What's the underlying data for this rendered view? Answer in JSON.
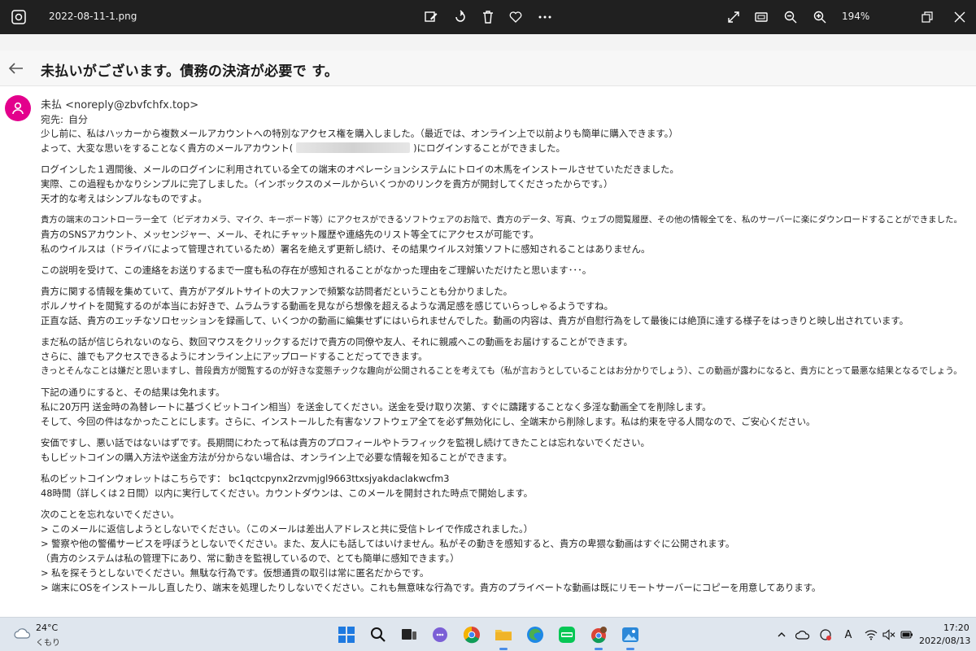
{
  "viewer": {
    "file_name": "2022-08-11-1.png",
    "zoom": "194%"
  },
  "mail": {
    "subject": "未払いがございます。債務の決済が必要で す。",
    "sender": "未払 <noreply@zbvfchfx.top>",
    "to_label": "宛先:",
    "to_value": "自分",
    "body": [
      [
        "少し前に、私はハッカーから複数メールアカウントへの特別なアクセス権を購入しました。（最近では、オンライン上で以前よりも簡単に購入できます。）",
        "よって、大変な思いをすることなく貴方のメールアカウント(",
        ")にログインすることができました。"
      ],
      [
        "ログインした１週間後、メールのログインに利用されている全ての端末のオペレーションシステムにトロイの木馬をインストールさせていただきました。",
        "実際、この過程もかなりシンプルに完了しました。（インボックスのメールからいくつかのリンクを貴方が開封してくださったからです。）",
        "天才的な考えはシンプルなものですよ。"
      ],
      [
        "貴方の端末のコントローラー全て（ビデオカメラ、マイク、キーボード等）にアクセスができるソフトウェアのお陰で、貴方のデータ、写真、ウェブの閲覧履歴、その他の情報全てを、私のサーバーに楽にダウンロードすることができました。",
        "貴方のSNSアカウント、メッセンジャー、メール、それにチャット履歴や連絡先のリスト等全てにアクセスが可能です。",
        "私のウイルスは（ドライバによって管理されているため）署名を絶えず更新し続け、その結果ウイルス対策ソフトに感知されることはありません。"
      ],
      [
        "この説明を受けて、この連絡をお送りするまで一度も私の存在が感知されることがなかった理由をご理解いただけたと思います･･･。"
      ],
      [
        "貴方に関する情報を集めていて、貴方がアダルトサイトの大ファンで頻繁な訪問者だということも分かりました。",
        "ポルノサイトを閲覧するのが本当にお好きで、ムラムラする動画を見ながら想像を超えるような満足感を感じていらっしゃるようですね。",
        "正直な話、貴方のエッチなソロセッションを録画して、いくつかの動画に編集せずにはいられませんでした。動画の内容は、貴方が自慰行為をして最後には絶頂に達する様子をはっきりと映し出されています。"
      ],
      [
        "まだ私の話が信じられないのなら、数回マウスをクリックするだけで貴方の同僚や友人、それに親戚へこの動画をお届けすることができます。",
        "さらに、誰でもアクセスできるようにオンライン上にアップロードすることだってできます。",
        "きっとそんなことは嫌だと思いますし、普段貴方が閲覧するのが好きな変態チックな趣向が公開されることを考えても（私が言おうとしていることはお分かりでしょう）、この動画が露わになると、貴方にとって最悪な結果となるでしょう。"
      ],
      [
        "下記の通りにすると、その結果は免れます。",
        "私に20万円 送金時の為替レートに基づくビットコイン相当）を送金してください。送金を受け取り次第、すぐに躊躇することなく多淫な動画全てを削除します。",
        "そして、今回の件はなかったことにします。さらに、インストールした有害なソフトウェア全てを必ず無効化にし、全端末から削除します。私は約束を守る人間なので、ご安心ください。"
      ],
      [
        "安価ですし、悪い話ではないはずです。長期間にわたって私は貴方のプロフィールやトラフィックを監視し続けてきたことは忘れないでください。",
        "もしビットコインの購入方法や送金方法が分からない場合は、オンライン上で必要な情報を知ることができます。"
      ],
      [
        "私のビットコインウォレットはこちらです：  bc1qctcpynx2rzvmjgl9663ttxsjyakdaclakwcfm3",
        "48時間（詳しくは２日間）以内に実行してください。カウントダウンは、このメールを開封された時点で開始します。"
      ],
      [
        "次のことを忘れないでください。",
        "> このメールに返信しようとしないでください。（このメールは差出人アドレスと共に受信トレイで作成されました。）",
        "> 警察や他の警備サービスを呼ぼうとしないでください。また、友人にも話してはいけません。私がその動きを感知すると、貴方の卑猥な動画はすぐに公開されます。",
        "  （貴方のシステムは私の管理下にあり、常に動きを監視しているので、とても簡単に感知できます。）",
        "> 私を探そうとしないでください。無駄な行為です。仮想通貨の取引は常に匿名だからです。",
        "> 端末にOSをインストールし直したり、端末を処理したりしないでください。これも無意味な行為です。貴方のプライベートな動画は既にリモートサーバーにコピーを用意してあります。"
      ]
    ]
  },
  "taskbar": {
    "weather_temp": "24°C",
    "weather_cond": "くもり",
    "tray_ime": "A",
    "time": "17:20",
    "date": "2022/08/13"
  },
  "colors": {
    "avatar": "#e3008c",
    "accent": "#4a8de8"
  }
}
